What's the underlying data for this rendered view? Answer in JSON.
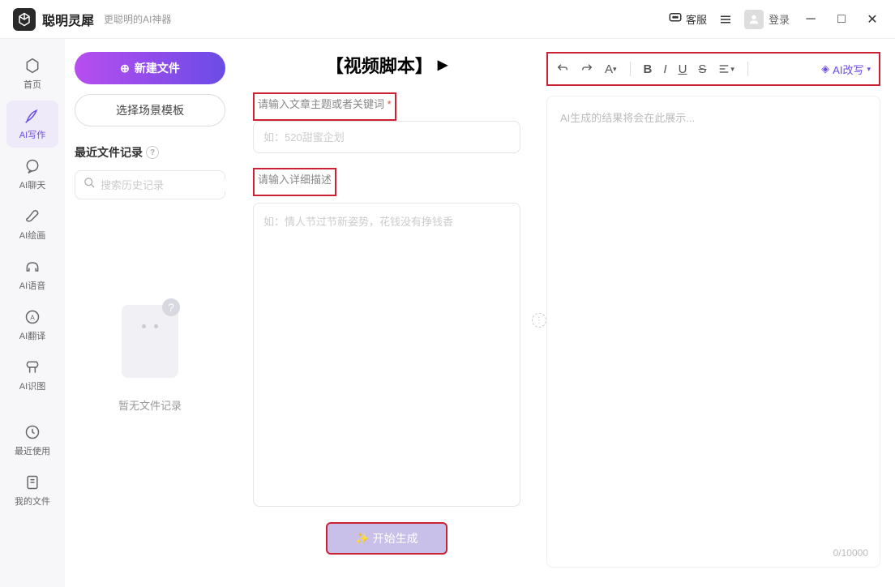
{
  "titlebar": {
    "app_name": "聪明灵犀",
    "tagline": "更聪明的AI神器",
    "customer_service": "客服",
    "login": "登录"
  },
  "sidebar": {
    "items": [
      {
        "label": "首页",
        "icon": "home"
      },
      {
        "label": "AI写作",
        "icon": "pen",
        "active": true
      },
      {
        "label": "AI聊天",
        "icon": "chat"
      },
      {
        "label": "AI绘画",
        "icon": "brush"
      },
      {
        "label": "AI语音",
        "icon": "headphone"
      },
      {
        "label": "AI翻译",
        "icon": "translate"
      },
      {
        "label": "AI识图",
        "icon": "image"
      },
      {
        "label": "最近使用",
        "icon": "history"
      },
      {
        "label": "我的文件",
        "icon": "file"
      }
    ]
  },
  "filecol": {
    "new_file": "新建文件",
    "choose_template": "选择场景模板",
    "recent_title": "最近文件记录",
    "search_placeholder": "搜索历史记录",
    "empty_text": "暂无文件记录"
  },
  "form": {
    "title": "【视频脚本】",
    "label_topic": "请输入文章主题或者关键词",
    "topic_placeholder": "如：520甜蜜企划",
    "label_detail": "请输入详细描述",
    "detail_placeholder": "如：情人节过节新姿势，花钱没有挣钱香",
    "generate_btn": "✨ 开始生成"
  },
  "output": {
    "placeholder": "AI生成的结果将会在此展示...",
    "ai_rewrite": "AI改写",
    "counter": "0/10000"
  }
}
